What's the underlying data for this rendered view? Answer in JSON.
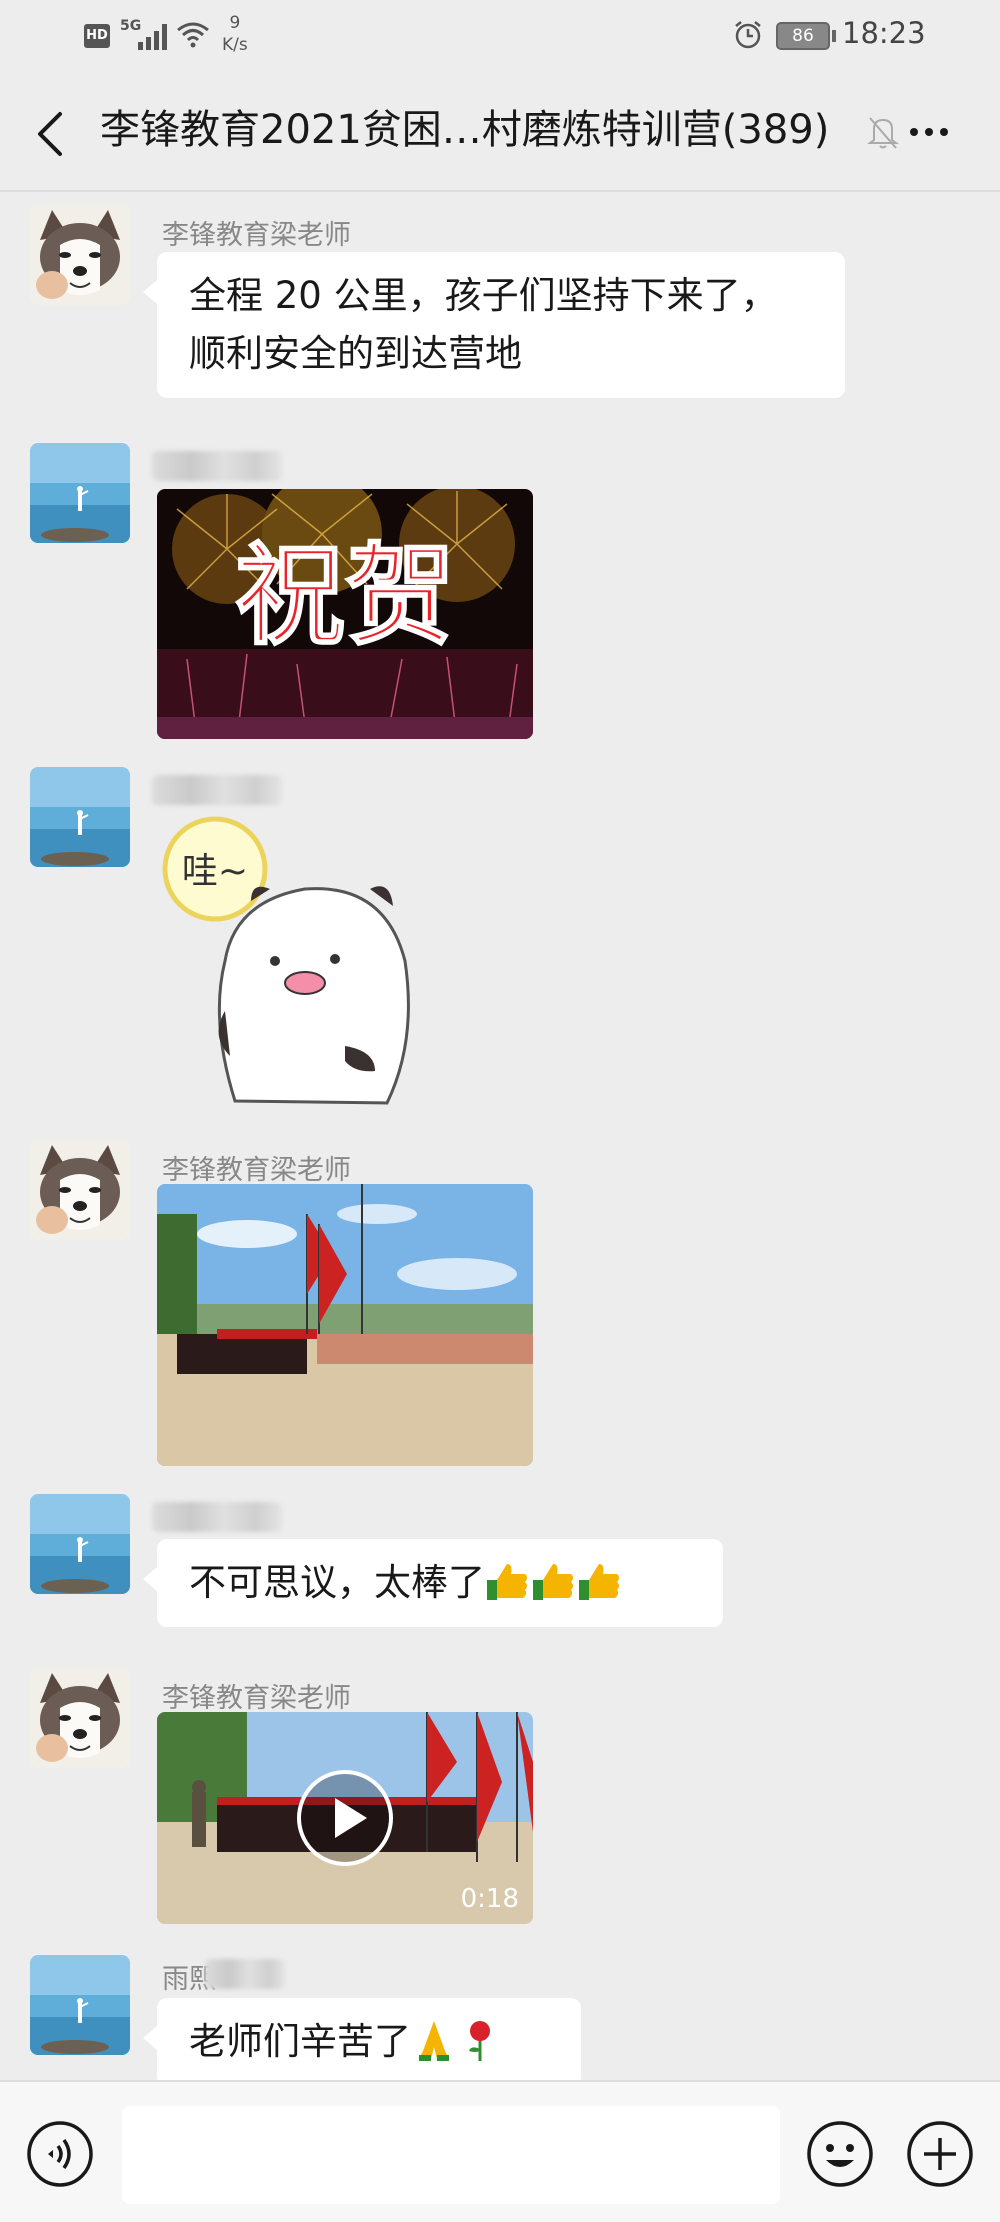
{
  "status_bar": {
    "hd": "HD",
    "network": "5G",
    "speed_value": "9",
    "speed_unit": "K/s",
    "battery": "86",
    "time": "18:23"
  },
  "header": {
    "title": "李锋教育2021贫困…村磨炼特训营(389)"
  },
  "messages": [
    {
      "sender": "李锋教育梁老师",
      "type": "text",
      "lines": [
        "全程 20 公里，孩子们坚持下来了，",
        "顺利安全的到达营地"
      ]
    },
    {
      "sender": "",
      "type": "image",
      "image_text": "祝贺"
    },
    {
      "sender": "",
      "type": "sticker",
      "sticker_text": "哇~"
    },
    {
      "sender": "李锋教育梁老师",
      "type": "image"
    },
    {
      "sender": "",
      "type": "text",
      "text": "不可思议，太棒了"
    },
    {
      "sender": "李锋教育梁老师",
      "type": "video",
      "duration": "0:18"
    },
    {
      "sender": "雨熙",
      "type": "text",
      "text": "老师们辛苦了"
    }
  ],
  "icons": {
    "back": "back-arrow-icon",
    "mute": "mute-bell-icon",
    "more": "more-dots-icon",
    "voice": "voice-icon",
    "emoji": "emoji-icon",
    "plus": "plus-icon"
  },
  "colors": {
    "background": "#ededed",
    "bubble": "#ffffff",
    "sender": "#888888",
    "input_bar": "#f7f7f7"
  }
}
